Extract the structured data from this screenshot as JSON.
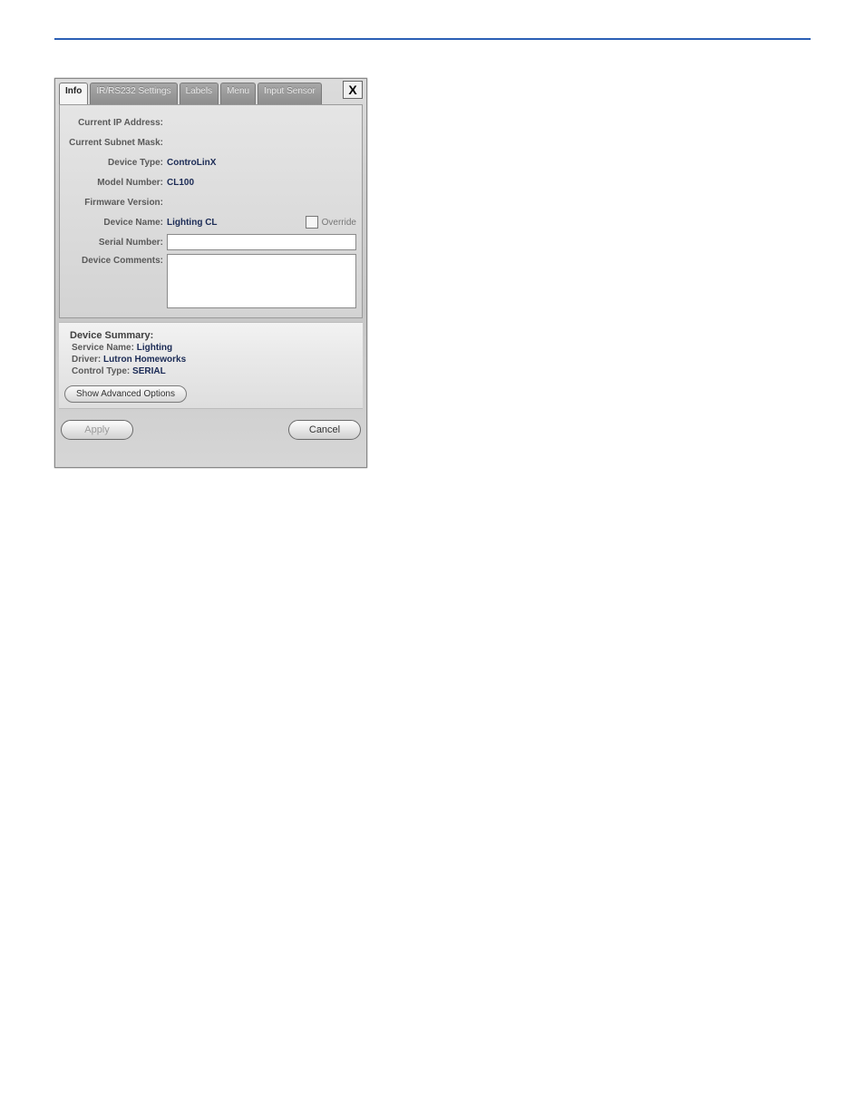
{
  "tabs": {
    "info": "Info",
    "ir_rs232": "IR/RS232 Settings",
    "labels": "Labels",
    "menu": "Menu",
    "input_sensor": "Input Sensor"
  },
  "close_label": "X",
  "fields": {
    "current_ip_label": "Current IP Address:",
    "current_ip_value": "",
    "current_subnet_label": "Current Subnet Mask:",
    "current_subnet_value": "",
    "device_type_label": "Device Type:",
    "device_type_value": "ControLinX",
    "model_number_label": "Model Number:",
    "model_number_value": "CL100",
    "firmware_version_label": "Firmware Version:",
    "firmware_version_value": "",
    "device_name_label": "Device Name:",
    "device_name_value": "Lighting CL",
    "override_label": "Override",
    "serial_number_label": "Serial Number:",
    "serial_number_value": "",
    "device_comments_label": "Device Comments:",
    "device_comments_value": ""
  },
  "summary": {
    "heading": "Device Summary:",
    "service_name_label": "Service Name:",
    "service_name_value": "Lighting",
    "driver_label": "Driver:",
    "driver_value": "Lutron Homeworks",
    "control_type_label": "Control Type:",
    "control_type_value": "SERIAL"
  },
  "buttons": {
    "advanced": "Show Advanced Options",
    "apply": "Apply",
    "cancel": "Cancel"
  }
}
